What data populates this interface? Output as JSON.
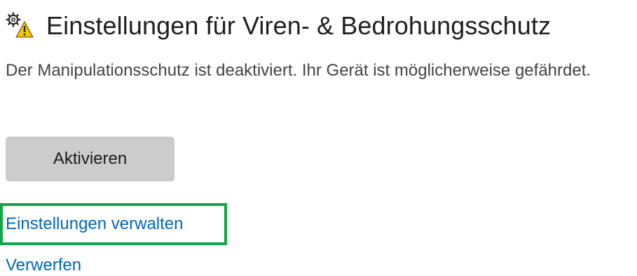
{
  "header": {
    "icon": "gear-warning-icon",
    "title": "Einstellungen für Viren- & Bedrohungsschutz"
  },
  "status": {
    "description": "Der Manipulationsschutz ist deaktiviert. Ihr Gerät ist möglicherweise gefährdet."
  },
  "actions": {
    "activate_label": "Aktivieren",
    "manage_settings_label": "Einstellungen verwalten",
    "dismiss_label": "Verwerfen"
  },
  "colors": {
    "link": "#0067b8",
    "button_bg": "#cccccc",
    "focus_outline": "#14a34a",
    "warning": "#f5c400"
  }
}
